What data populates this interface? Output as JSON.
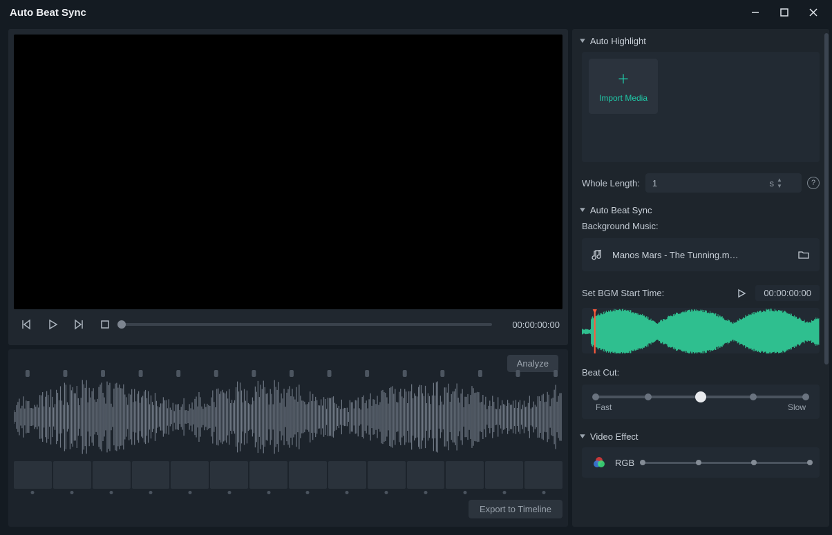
{
  "window": {
    "title": "Auto Beat Sync"
  },
  "transport": {
    "time": "00:00:00:00"
  },
  "analysis": {
    "analyze_label": "Analyze",
    "export_label": "Export to Timeline"
  },
  "sections": {
    "autoHighlight": {
      "title": "Auto Highlight",
      "import_label": "Import Media",
      "wholeLength": {
        "label": "Whole Length:",
        "value": "1",
        "unit": "s"
      }
    },
    "autoBeatSync": {
      "title": "Auto Beat Sync",
      "bgm_label": "Background Music:",
      "bgm_file": "Manos Mars - The Tunning.m…",
      "startTime_label": "Set BGM Start Time:",
      "startTime_value": "00:00:00:00",
      "beatCut_label": "Beat Cut:",
      "fast_label": "Fast",
      "slow_label": "Slow",
      "ticks": 5,
      "value_index": 2
    },
    "videoEffect": {
      "title": "Video Effect",
      "preset": "RGB"
    }
  }
}
